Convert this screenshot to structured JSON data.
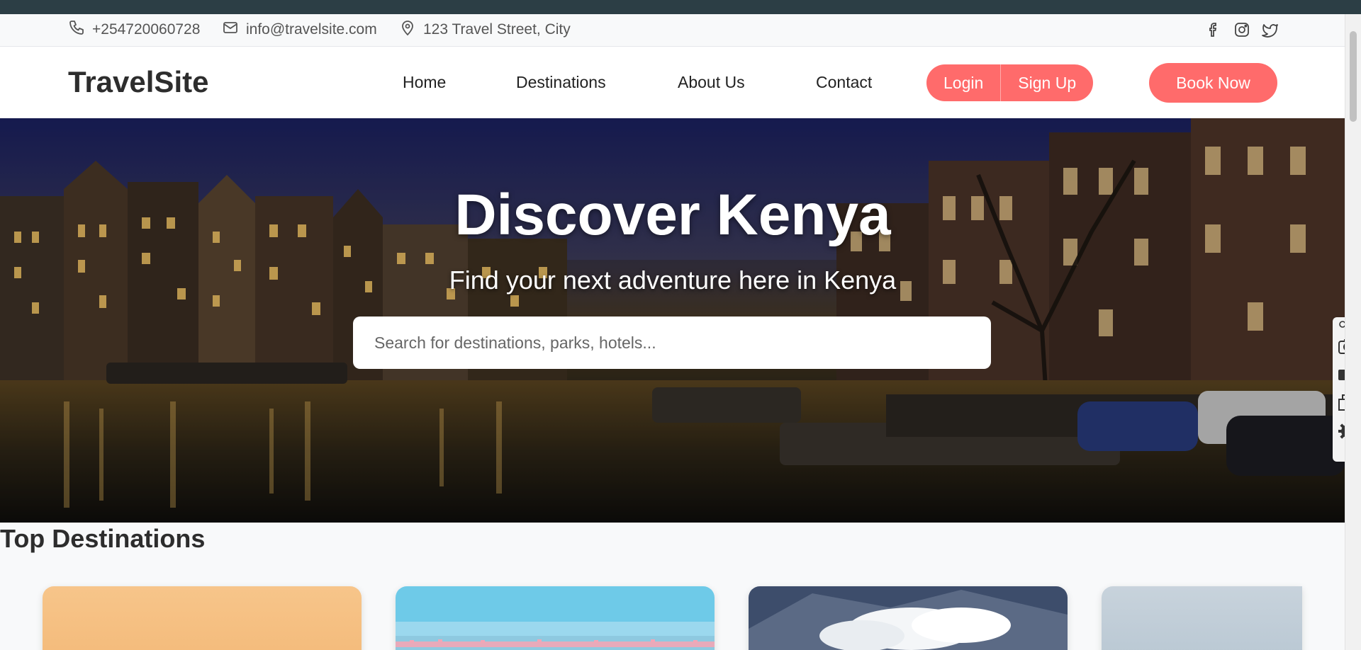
{
  "topbar": {
    "phone": "+254720060728",
    "email": "info@travelsite.com",
    "address": "123 Travel Street, City",
    "social": [
      "facebook-icon",
      "instagram-icon",
      "twitter-icon"
    ]
  },
  "header": {
    "logo": "TravelSite",
    "nav": [
      "Home",
      "Destinations",
      "About Us",
      "Contact"
    ],
    "login_label": "Login",
    "signup_label": "Sign Up",
    "book_label": "Book Now"
  },
  "hero": {
    "title": "Discover Kenya",
    "subtitle": "Find your next adventure here in Kenya",
    "search_placeholder": "Search for destinations, parks, hotels..."
  },
  "destinations": {
    "heading": "Top Destinations",
    "cards": [
      "desert-card",
      "flamingo-lake-card",
      "mountain-card",
      "sky-card"
    ]
  },
  "colors": {
    "accent": "#ff6b6b",
    "page_bg": "#f8f9fa",
    "frame": "#2c3e45"
  },
  "side_tools": [
    "pin-icon",
    "camera-icon",
    "video-icon",
    "windows-icon",
    "gear-icon"
  ]
}
